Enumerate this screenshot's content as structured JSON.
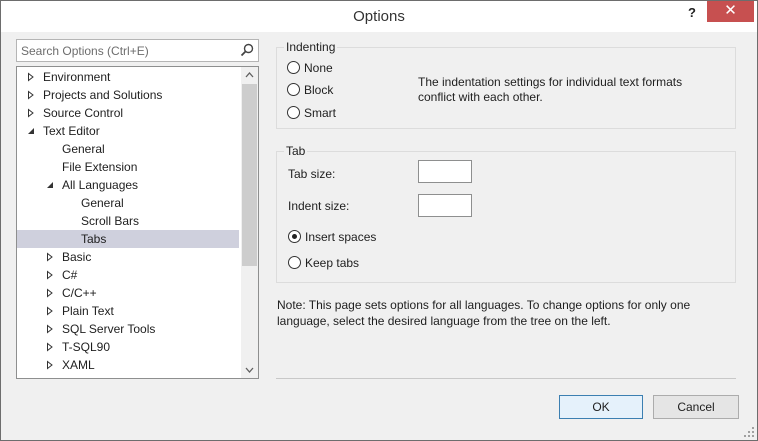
{
  "window": {
    "title": "Options",
    "help_glyph": "?",
    "close_glyph": "✕"
  },
  "search": {
    "placeholder": "Search Options (Ctrl+E)",
    "value": ""
  },
  "tree": {
    "items": [
      {
        "label": "Environment",
        "state": "collapsed",
        "level": 0
      },
      {
        "label": "Projects and Solutions",
        "state": "collapsed",
        "level": 0
      },
      {
        "label": "Source Control",
        "state": "collapsed",
        "level": 0
      },
      {
        "label": "Text Editor",
        "state": "expanded",
        "level": 0
      },
      {
        "label": "General",
        "state": "leaf",
        "level": 1
      },
      {
        "label": "File Extension",
        "state": "leaf",
        "level": 1
      },
      {
        "label": "All Languages",
        "state": "expanded",
        "level": 1
      },
      {
        "label": "General",
        "state": "leaf",
        "level": 2
      },
      {
        "label": "Scroll Bars",
        "state": "leaf",
        "level": 2
      },
      {
        "label": "Tabs",
        "state": "leaf",
        "level": 2,
        "selected": true
      },
      {
        "label": "Basic",
        "state": "collapsed",
        "level": 1
      },
      {
        "label": "C#",
        "state": "collapsed",
        "level": 1
      },
      {
        "label": "C/C++",
        "state": "collapsed",
        "level": 1
      },
      {
        "label": "Plain Text",
        "state": "collapsed",
        "level": 1
      },
      {
        "label": "SQL Server Tools",
        "state": "collapsed",
        "level": 1
      },
      {
        "label": "T-SQL90",
        "state": "collapsed",
        "level": 1
      },
      {
        "label": "XAML",
        "state": "collapsed",
        "level": 1
      },
      {
        "label": "XML",
        "state": "collapsed",
        "level": 1
      }
    ]
  },
  "indenting": {
    "title": "Indenting",
    "options": [
      {
        "label": "None",
        "checked": false
      },
      {
        "label": "Block",
        "checked": false
      },
      {
        "label": "Smart",
        "checked": false
      }
    ],
    "conflict_line1": "The indentation settings for individual text formats",
    "conflict_line2": "conflict with each other."
  },
  "tab": {
    "title": "Tab",
    "tab_size_label": "Tab size:",
    "tab_size_value": "",
    "indent_size_label": "Indent size:",
    "indent_size_value": "",
    "options": [
      {
        "label": "Insert spaces",
        "checked": true
      },
      {
        "label": "Keep tabs",
        "checked": false
      }
    ]
  },
  "note": {
    "line1": "Note: This page sets options for all languages. To change options for only one",
    "line2": "language, select the desired language from the tree on the left."
  },
  "buttons": {
    "ok": "OK",
    "cancel": "Cancel"
  },
  "colors": {
    "close_button": "#c75050",
    "selection": "#cfd0dd",
    "default_button_border": "#3c7fb1"
  }
}
